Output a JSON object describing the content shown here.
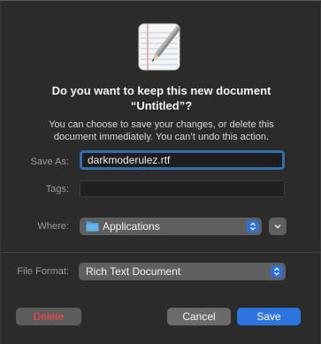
{
  "dialog": {
    "title_line1": "Do you want to keep this new document",
    "title_line2": "“Untitled”?",
    "message_line1": "You can choose to save your changes, or delete this",
    "message_line2": "document immediately. You can’t undo this action."
  },
  "form": {
    "save_as_label": "Save As:",
    "save_as_value": "darkmoderulez.rtf",
    "tags_label": "Tags:",
    "tags_value": "",
    "where_label": "Where:",
    "where_value": "Applications",
    "where_icon": "folder-icon",
    "file_format_label": "File Format:",
    "file_format_value": "Rich Text Document"
  },
  "buttons": {
    "delete_label": "Delete",
    "cancel_label": "Cancel",
    "save_label": "Save"
  },
  "colors": {
    "accent": "#2d74de",
    "destructive": "#ff453a",
    "dialog_bg": "#2b2b2b"
  },
  "icons": {
    "app_icon": "textedit-document-icon",
    "stepper": "chevron-up-down-icon",
    "expand": "chevron-down-icon"
  }
}
